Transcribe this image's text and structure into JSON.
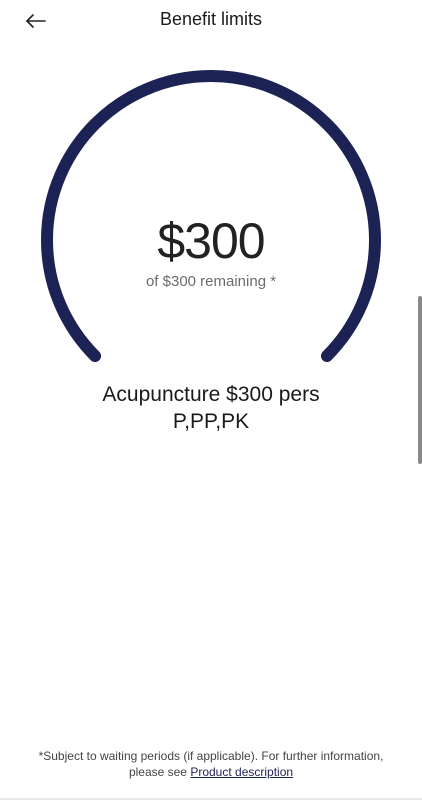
{
  "header": {
    "back_icon": "arrow-left-icon",
    "title": "Benefit limits"
  },
  "gauge": {
    "amount": "$300",
    "remaining_text": "of $300 remaining *",
    "remaining_fraction": 1.0,
    "arc_color": "#1c2354"
  },
  "benefit": {
    "name": "Acupuncture $300 pers",
    "sub": "P,PP,PK"
  },
  "footer": {
    "note": "*Subject to waiting periods (if applicable). For further information, please see ",
    "link_label": "Product description"
  }
}
